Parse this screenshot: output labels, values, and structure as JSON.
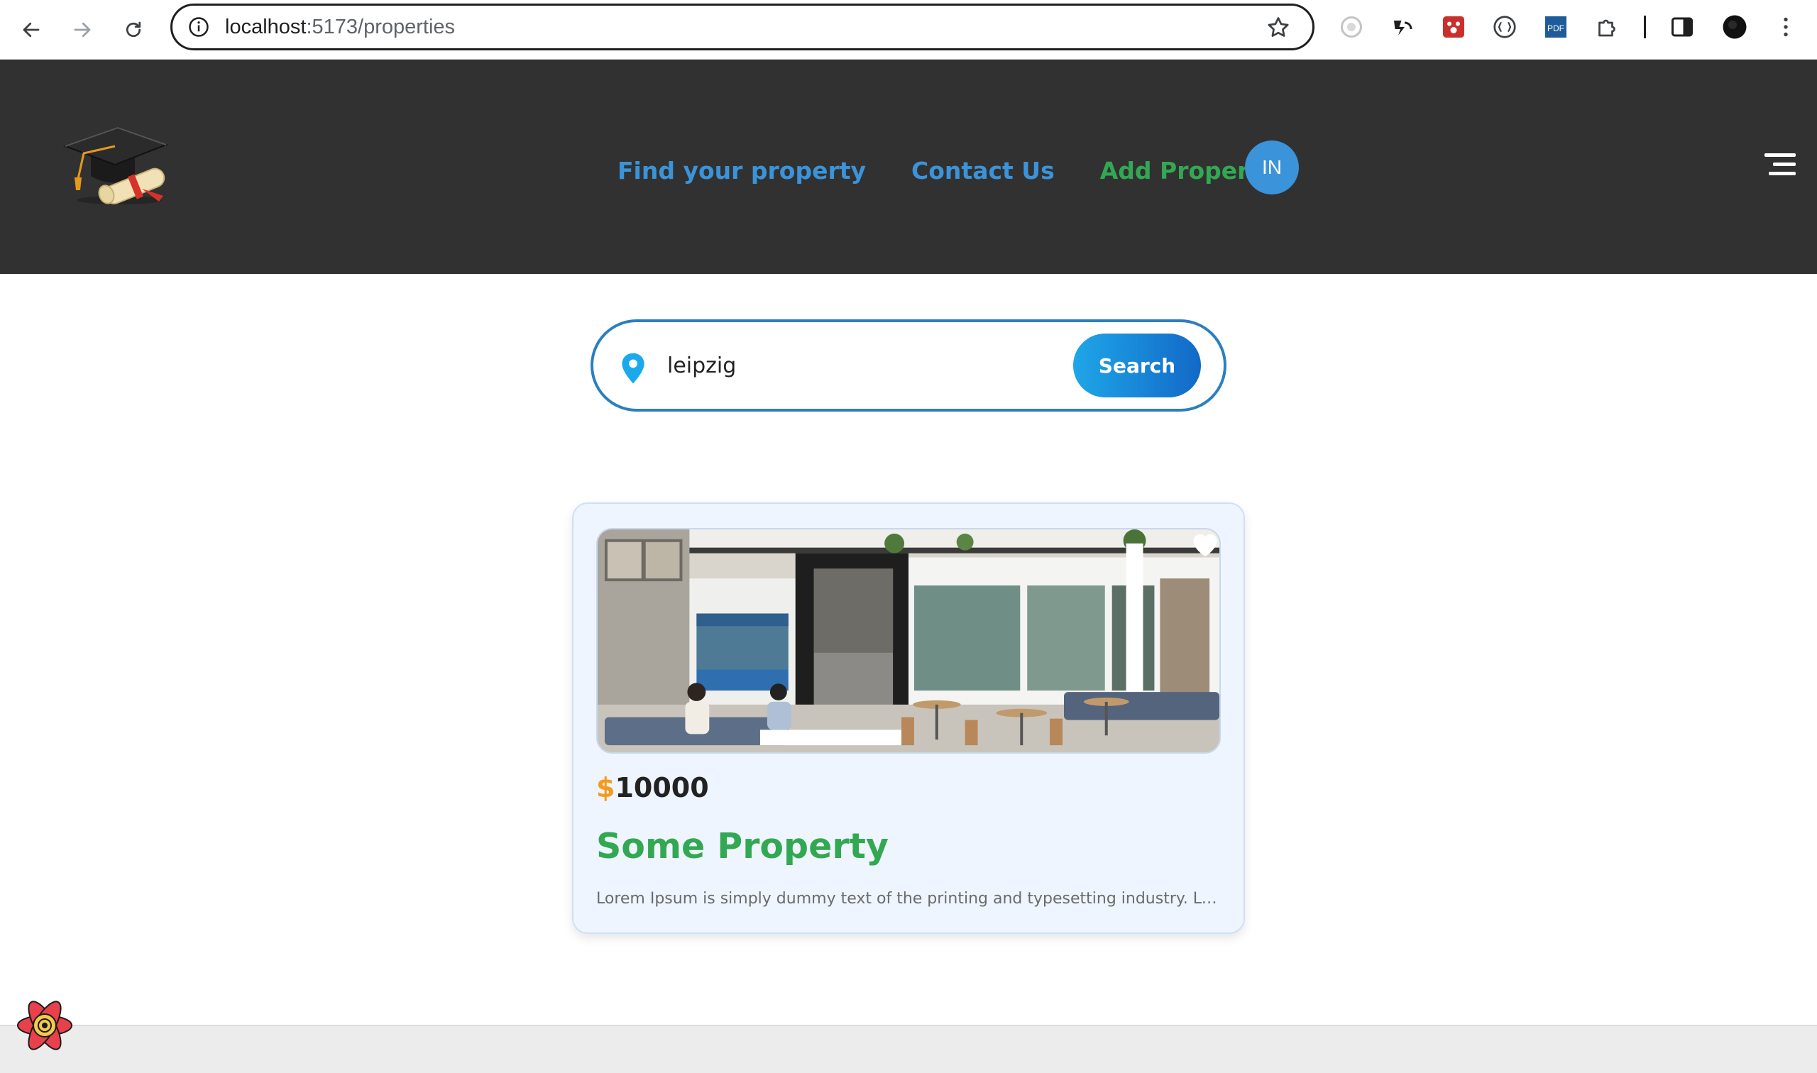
{
  "browser": {
    "url_host": "localhost",
    "url_path": ":5173/properties",
    "extension_icons": [
      "privacy-extension-icon",
      "readaloud-extension-icon",
      "paw-extension-icon",
      "json-viewer-extension-icon",
      "pdf-extension-icon",
      "puzzle-extensions-icon"
    ],
    "pdf_badge": "PDF"
  },
  "header": {
    "nav": {
      "find_property": "Find your property",
      "contact_us": "Contact Us",
      "add_property": "Add Property"
    },
    "user_initials": "IN"
  },
  "search": {
    "value": "leipzig",
    "button_label": "Search"
  },
  "properties": [
    {
      "currency": "$",
      "price": "10000",
      "title": "Some Property",
      "description": "Lorem Ipsum is simply dummy text of the printing and typesetting industry. Lorem Ipsum has been the industry's standard dummy text",
      "favorite": false
    }
  ],
  "colors": {
    "header_bg": "#313131",
    "nav_blue": "#3b93d9",
    "nav_green": "#33a852",
    "price_currency": "#f59a1b",
    "card_bg": "#eef5fe"
  }
}
